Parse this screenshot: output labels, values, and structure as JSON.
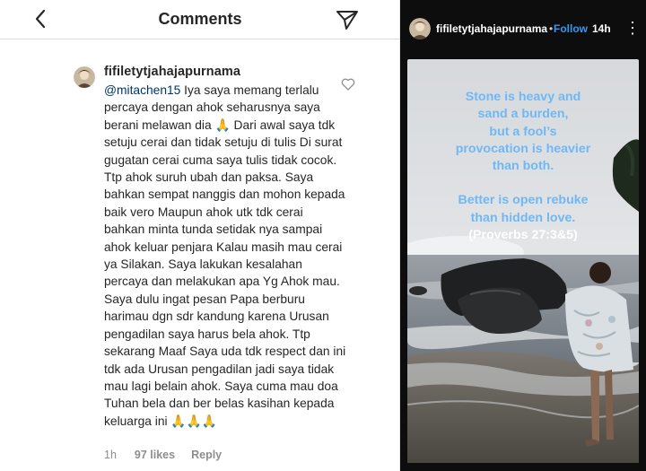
{
  "comments_panel": {
    "title": "Comments",
    "comment": {
      "username": "fifiletytjahajapurnama",
      "mention": "@mitachen15",
      "text": " Iya saya memang terlalu percaya dengan ahok seharusnya saya berani melawan dia 🙏 Dari awal saya tdk setuju cerai dan tidak setuju di tulis Di surat gugatan cerai cuma saya tulis tidak cocok. Ttp ahok suruh ubah dan paksa. Saya bahkan sempat nanggis dan mohon kepada baik vero Maupun ahok utk tdk cerai bahkan minta tunda setidak nya sampai ahok keluar penjara Kalau masih mau cerai ya Silakan. Saya lakukan kesalahan percaya dan melakukan apa Yg Ahok mau. Saya dulu ingat pesan Papa berburu harimau dgn sdr kandung karena Urusan pengadilan saya harus bela ahok. Ttp sekarang Maaf Saya uda tdk respect dan ini tdk ada Urusan pengadilan jadi saya tidak mau lagi belain ahok. Saya cuma mau doa Tuhan bela dan ber belas kasihan kepada keluarga ini 🙏🙏🙏",
      "time": "1h",
      "likes": "97 likes",
      "reply": "Reply"
    },
    "icons": {
      "back": "chevron-left-icon",
      "share": "paper-plane-icon",
      "like": "heart-outline-icon"
    }
  },
  "story_panel": {
    "username": "fifiletytjahajapurnama",
    "separator": "•",
    "follow": "Follow",
    "time": "14h",
    "more": "⋮",
    "quote_lines": [
      "Stone is heavy and",
      "sand a burden,",
      "but a fool’s",
      "provocation is heavier",
      "than both.",
      "",
      "Better is open rebuke",
      "than hidden love."
    ],
    "quote_reference": "(Proverbs 27:3&5)"
  },
  "colors": {
    "accent_link": "#3897f0",
    "mention": "#003569",
    "quote_text": "#6fb8f5",
    "muted": "#8e8e8e"
  }
}
